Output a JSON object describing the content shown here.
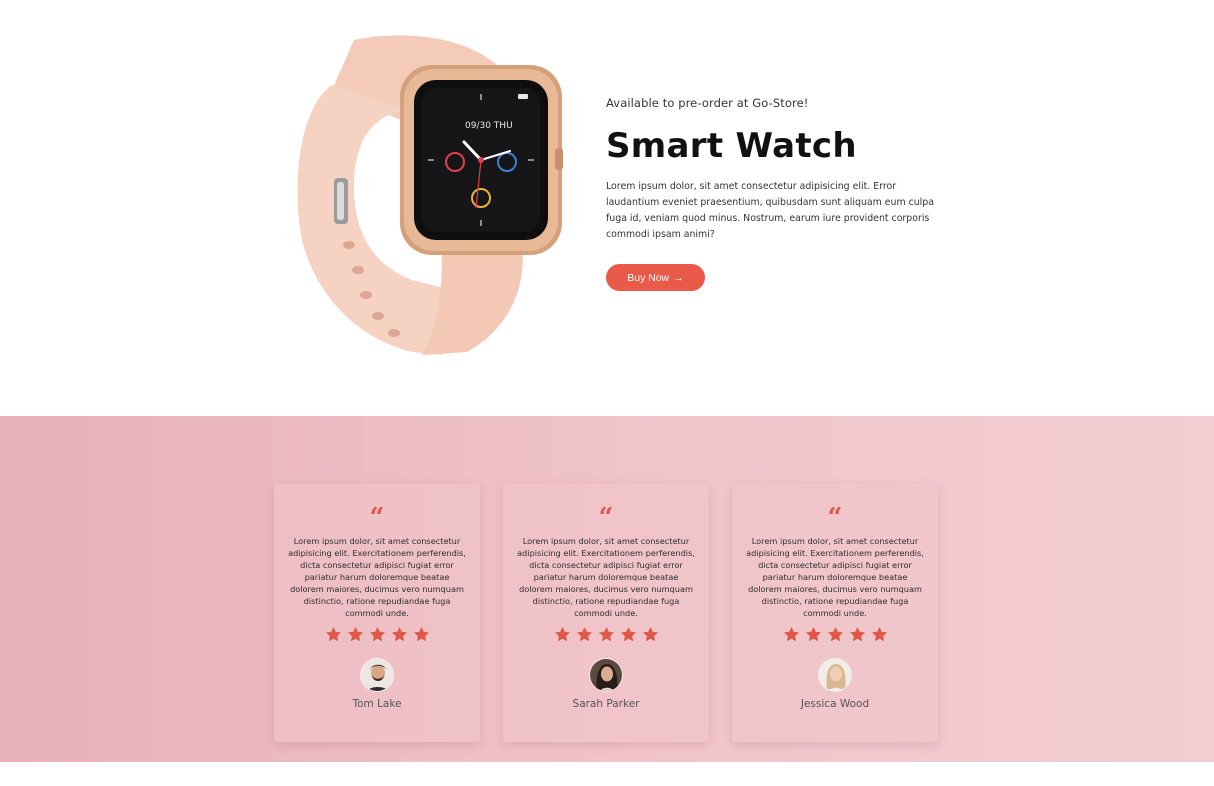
{
  "hero": {
    "eyebrow": "Available to pre-order at Go-Store!",
    "title": "Smart Watch",
    "description": "Lorem ipsum dolor, sit amet consectetur adipisicing elit. Error laudantium eveniet praesentium, quibusdam sunt aliquam eum culpa fuga id, veniam quod minus. Nostrum, earum iure provident corporis commodi ipsam animi?",
    "button_label": "Buy Now",
    "button_arrow": "→",
    "watch_screen": {
      "date": "09/30 THU"
    }
  },
  "colors": {
    "accent": "#ea5a48",
    "testimonials_bg_start": "#e8b0b9",
    "testimonials_bg_end": "#f3cdd2",
    "strap": "#f6d2c2",
    "case": "#d9a27c"
  },
  "testimonials": [
    {
      "quote_icon": "“",
      "text": "Lorem ipsum dolor, sit amet consectetur adipisicing elit. Exercitationem perferendis, dicta consectetur adipisci fugiat error pariatur harum doloremque beatae dolorem maiores, ducimus vero numquam distinctio, ratione repudiandae fuga commodi unde.",
      "rating": 5,
      "name": "Tom Lake"
    },
    {
      "quote_icon": "“",
      "text": "Lorem ipsum dolor, sit amet consectetur adipisicing elit. Exercitationem perferendis, dicta consectetur adipisci fugiat error pariatur harum doloremque beatae dolorem maiores, ducimus vero numquam distinctio, ratione repudiandae fuga commodi unde.",
      "rating": 5,
      "name": "Sarah Parker"
    },
    {
      "quote_icon": "“",
      "text": "Lorem ipsum dolor, sit amet consectetur adipisicing elit. Exercitationem perferendis, dicta consectetur adipisci fugiat error pariatur harum doloremque beatae dolorem maiores, ducimus vero numquam distinctio, ratione repudiandae fuga commodi unde.",
      "rating": 5,
      "name": "Jessica Wood"
    }
  ]
}
